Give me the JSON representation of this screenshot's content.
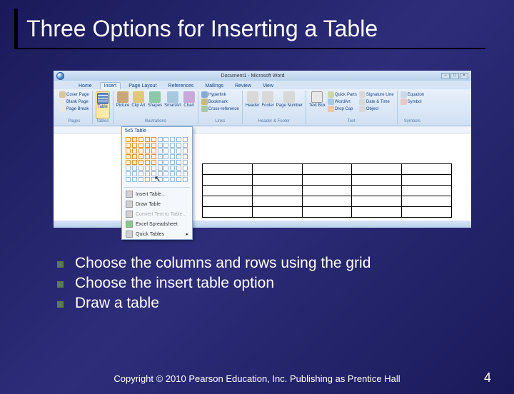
{
  "slide": {
    "title": "Three Options for Inserting a Table",
    "bullets": [
      "Choose the columns and rows using the grid",
      "Choose the insert table option",
      "Draw a table"
    ],
    "copyright": "Copyright © 2010 Pearson Education, Inc. Publishing as Prentice Hall",
    "page_number": "4"
  },
  "word": {
    "title": "Document1 - Microsoft Word",
    "tabs": [
      "Home",
      "Insert",
      "Page Layout",
      "References",
      "Mailings",
      "Review",
      "View"
    ],
    "active_tab": "Insert",
    "groups": {
      "pages": {
        "label": "Pages",
        "items": [
          "Cover Page",
          "Blank Page",
          "Page Break"
        ]
      },
      "tables": {
        "label": "Tables",
        "items": [
          "Table"
        ]
      },
      "illustrations": {
        "label": "Illustrations",
        "items": [
          "Picture",
          "Clip Art",
          "Shapes",
          "SmartArt",
          "Chart"
        ]
      },
      "links": {
        "label": "Links",
        "items": [
          "Hyperlink",
          "Bookmark",
          "Cross-reference"
        ]
      },
      "header_footer": {
        "label": "Header & Footer",
        "items": [
          "Header",
          "Footer",
          "Page Number"
        ]
      },
      "text": {
        "label": "Text",
        "items": [
          "Text Box",
          "Quick Parts",
          "WordArt",
          "Drop Cap",
          "Signature Line",
          "Date & Time",
          "Object"
        ]
      },
      "symbols": {
        "label": "Symbols",
        "items": [
          "Equation",
          "Symbol"
        ]
      }
    },
    "dropdown": {
      "title": "5x5 Table",
      "grid_rows": 8,
      "grid_cols": 10,
      "selected_rows": 5,
      "selected_cols": 5,
      "menu_items": [
        {
          "label": "Insert Table...",
          "enabled": true
        },
        {
          "label": "Draw Table",
          "enabled": true
        },
        {
          "label": "Convert Text to Table...",
          "enabled": false
        },
        {
          "label": "Excel Spreadsheet",
          "enabled": true
        },
        {
          "label": "Quick Tables",
          "enabled": true
        }
      ]
    },
    "preview_table": {
      "rows": 5,
      "cols": 5
    }
  }
}
